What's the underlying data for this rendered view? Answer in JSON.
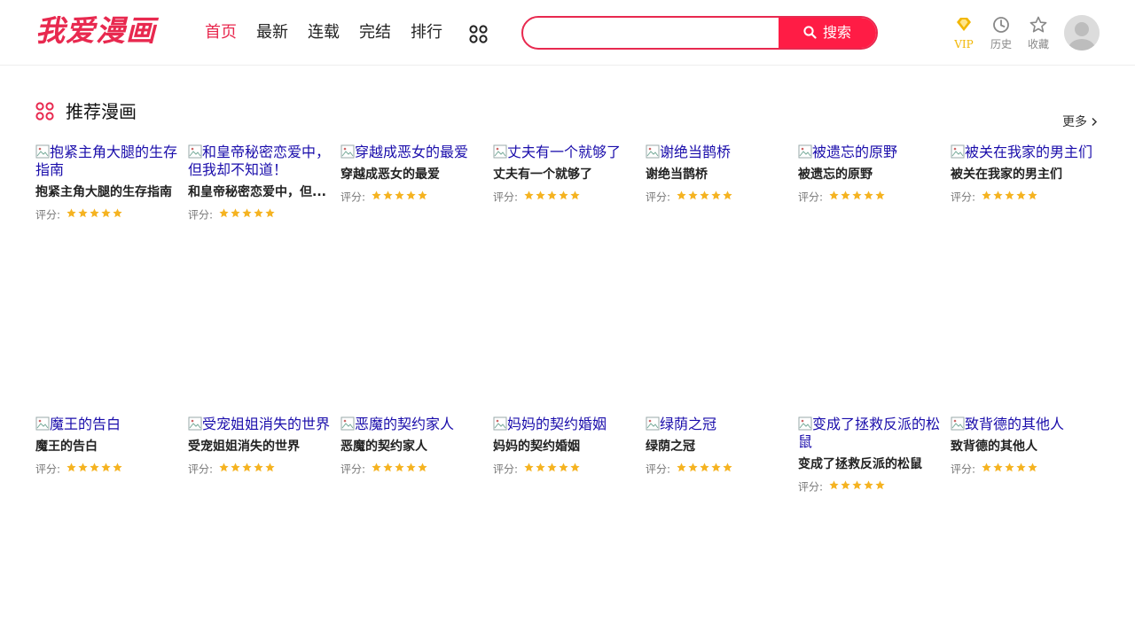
{
  "header": {
    "logo": "我爱漫画",
    "nav": [
      {
        "label": "首页",
        "active": true
      },
      {
        "label": "最新",
        "active": false
      },
      {
        "label": "连载",
        "active": false
      },
      {
        "label": "完结",
        "active": false
      },
      {
        "label": "排行",
        "active": false
      }
    ],
    "nav_more_icon": "grid-icon",
    "search": {
      "value": "",
      "placeholder": "",
      "button_label": "搜索",
      "icon": "search-icon"
    },
    "tools": [
      {
        "label": "VIP",
        "icon": "diamond-icon"
      },
      {
        "label": "历史",
        "icon": "clock-icon"
      },
      {
        "label": "收藏",
        "icon": "star-icon"
      }
    ],
    "avatar": "avatar"
  },
  "section": {
    "title": "推荐漫画",
    "icon": "grid-icon",
    "more_label": "更多"
  },
  "rating_label": "评分:",
  "rating_stars": 5,
  "comics": [
    {
      "alt": "抱紧主角大腿的生存指南",
      "title": "抱紧主角大腿的生存指南"
    },
    {
      "alt": "和皇帝秘密恋爱中，但我却不知道！",
      "title": "和皇帝秘密恋爱中，但..."
    },
    {
      "alt": "穿越成恶女的最爱",
      "title": "穿越成恶女的最爱"
    },
    {
      "alt": "丈夫有一个就够了",
      "title": "丈夫有一个就够了"
    },
    {
      "alt": "谢绝当鹊桥",
      "title": "谢绝当鹊桥"
    },
    {
      "alt": "被遗忘的原野",
      "title": "被遗忘的原野"
    },
    {
      "alt": "被关在我家的男主们",
      "title": "被关在我家的男主们"
    },
    {
      "alt": "魔王的告白",
      "title": "魔王的告白"
    },
    {
      "alt": "受宠姐姐消失的世界",
      "title": "受宠姐姐消失的世界"
    },
    {
      "alt": "恶魔的契约家人",
      "title": "恶魔的契约家人"
    },
    {
      "alt": "妈妈的契约婚姻",
      "title": "妈妈的契约婚姻"
    },
    {
      "alt": "绿荫之冠",
      "title": "绿荫之冠"
    },
    {
      "alt": "变成了拯救反派的松鼠",
      "title": "变成了拯救反派的松鼠"
    },
    {
      "alt": "致背德的其他人",
      "title": "致背德的其他人"
    }
  ],
  "colors": {
    "accent": "#e8294f",
    "search_button": "#ff1c45",
    "vip": "#f2b705",
    "star": "#f5b321",
    "link": "#1a0dab"
  }
}
